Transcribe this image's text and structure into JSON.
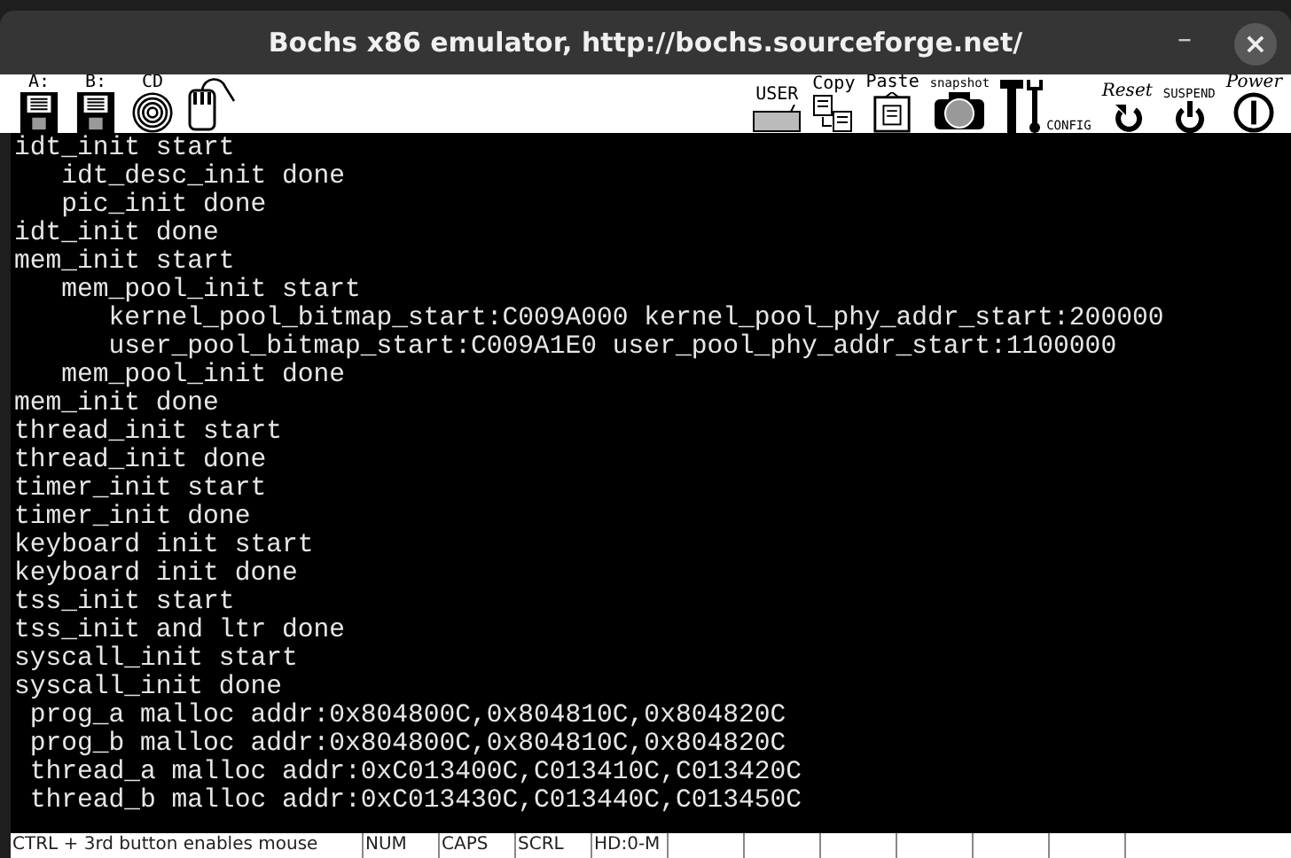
{
  "window": {
    "title": "Bochs x86 emulator, http://bochs.sourceforge.net/",
    "minimize": "–",
    "close": "×"
  },
  "toolbar_left": [
    {
      "label": "A:",
      "kind": "floppy"
    },
    {
      "label": "B:",
      "kind": "floppy"
    },
    {
      "label": "CD",
      "kind": "cd"
    },
    {
      "kind": "mouse"
    }
  ],
  "toolbar_right": [
    {
      "label": "USER",
      "kind": "keyboard"
    },
    {
      "label": "Copy",
      "kind": "copy"
    },
    {
      "label": "Paste",
      "kind": "paste"
    },
    {
      "label": "snapshot",
      "kind": "camera"
    },
    {
      "label": "CONFIG",
      "kind": "config"
    },
    {
      "label": "Reset",
      "kind": "reset"
    },
    {
      "label": "SUSPEND",
      "kind": "suspend"
    },
    {
      "label": "Power",
      "kind": "power"
    }
  ],
  "console": [
    "idt_init start",
    "   idt_desc_init done",
    "   pic_init done",
    "idt_init done",
    "mem_init start",
    "   mem_pool_init start",
    "      kernel_pool_bitmap_start:C009A000 kernel_pool_phy_addr_start:200000",
    "      user_pool_bitmap_start:C009A1E0 user_pool_phy_addr_start:1100000",
    "   mem_pool_init done",
    "mem_init done",
    "thread_init start",
    "thread_init done",
    "timer_init start",
    "timer_init done",
    "keyboard init start",
    "keyboard init done",
    "tss_init start",
    "tss_init and ltr done",
    "syscall_init start",
    "syscall_init done",
    " prog_a malloc addr:0x804800C,0x804810C,0x804820C",
    " prog_b malloc addr:0x804800C,0x804810C,0x804820C",
    " thread_a malloc addr:0xC013400C,C013410C,C013420C",
    " thread_b malloc addr:0xC013430C,C013440C,C013450C"
  ],
  "status_bar": [
    "CTRL + 3rd button enables mouse",
    "NUM",
    "CAPS",
    "SCRL",
    "HD:0-M"
  ]
}
